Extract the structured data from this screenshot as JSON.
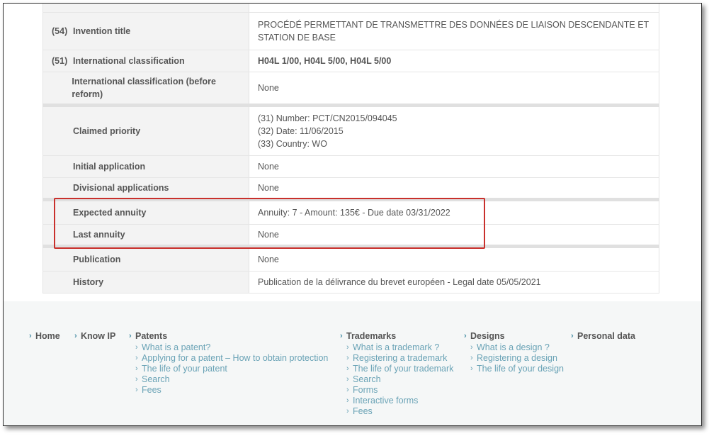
{
  "rows": [
    {
      "code": "",
      "label": "",
      "value": ""
    },
    {
      "code": "(54)",
      "label": "Invention title",
      "value": "PROCÉDÉ PERMETTANT DE TRANSMETTRE DES DONNÉES DE LIAISON DESCENDANTE ET STATION DE BASE"
    },
    {
      "code": "(51)",
      "label": "International classification",
      "value": "H04L 1/00, H04L 5/00, H04L 5/00"
    },
    {
      "code": "",
      "label": "International classification (before reform)",
      "value": "None"
    },
    {
      "code": "",
      "label": "Claimed priority",
      "lines": [
        "(31) Number: PCT/CN2015/094045",
        "(32) Date: 11/06/2015",
        "(33) Country: WO"
      ]
    },
    {
      "code": "",
      "label": "Initial application",
      "value": "None"
    },
    {
      "code": "",
      "label": "Divisional applications",
      "value": "None"
    },
    {
      "code": "",
      "label": "Expected annuity",
      "value": "Annuity: 7 - Amount: 135€ - Due date 03/31/2022"
    },
    {
      "code": "",
      "label": "Last annuity",
      "value": "None"
    },
    {
      "code": "",
      "label": "Publication",
      "value": "None"
    },
    {
      "code": "",
      "label": "History",
      "value": "Publication de la délivrance du brevet européen - Legal date 05/05/2021"
    }
  ],
  "footer": {
    "home": "Home",
    "know_ip": "Know IP",
    "patents": {
      "title": "Patents",
      "items": [
        "What is a patent?",
        "Applying for a patent – How to obtain protection",
        "The life of your patent",
        "Search",
        "Fees"
      ]
    },
    "trademarks": {
      "title": "Trademarks",
      "items": [
        "What is a trademark ?",
        "Registering a trademark",
        "The life of your trademark",
        "Search",
        "Forms",
        "Interactive forms",
        "Fees"
      ]
    },
    "designs": {
      "title": "Designs",
      "items": [
        "What is a design ?",
        "Registering a design",
        "The life of your design"
      ]
    },
    "personal_data": "Personal data"
  },
  "colors": {
    "highlight": "#c9302c",
    "link": "#4a8fa6",
    "label_bg": "#f3f3f3"
  },
  "icons": {
    "bullet": "chevron-right-icon"
  }
}
